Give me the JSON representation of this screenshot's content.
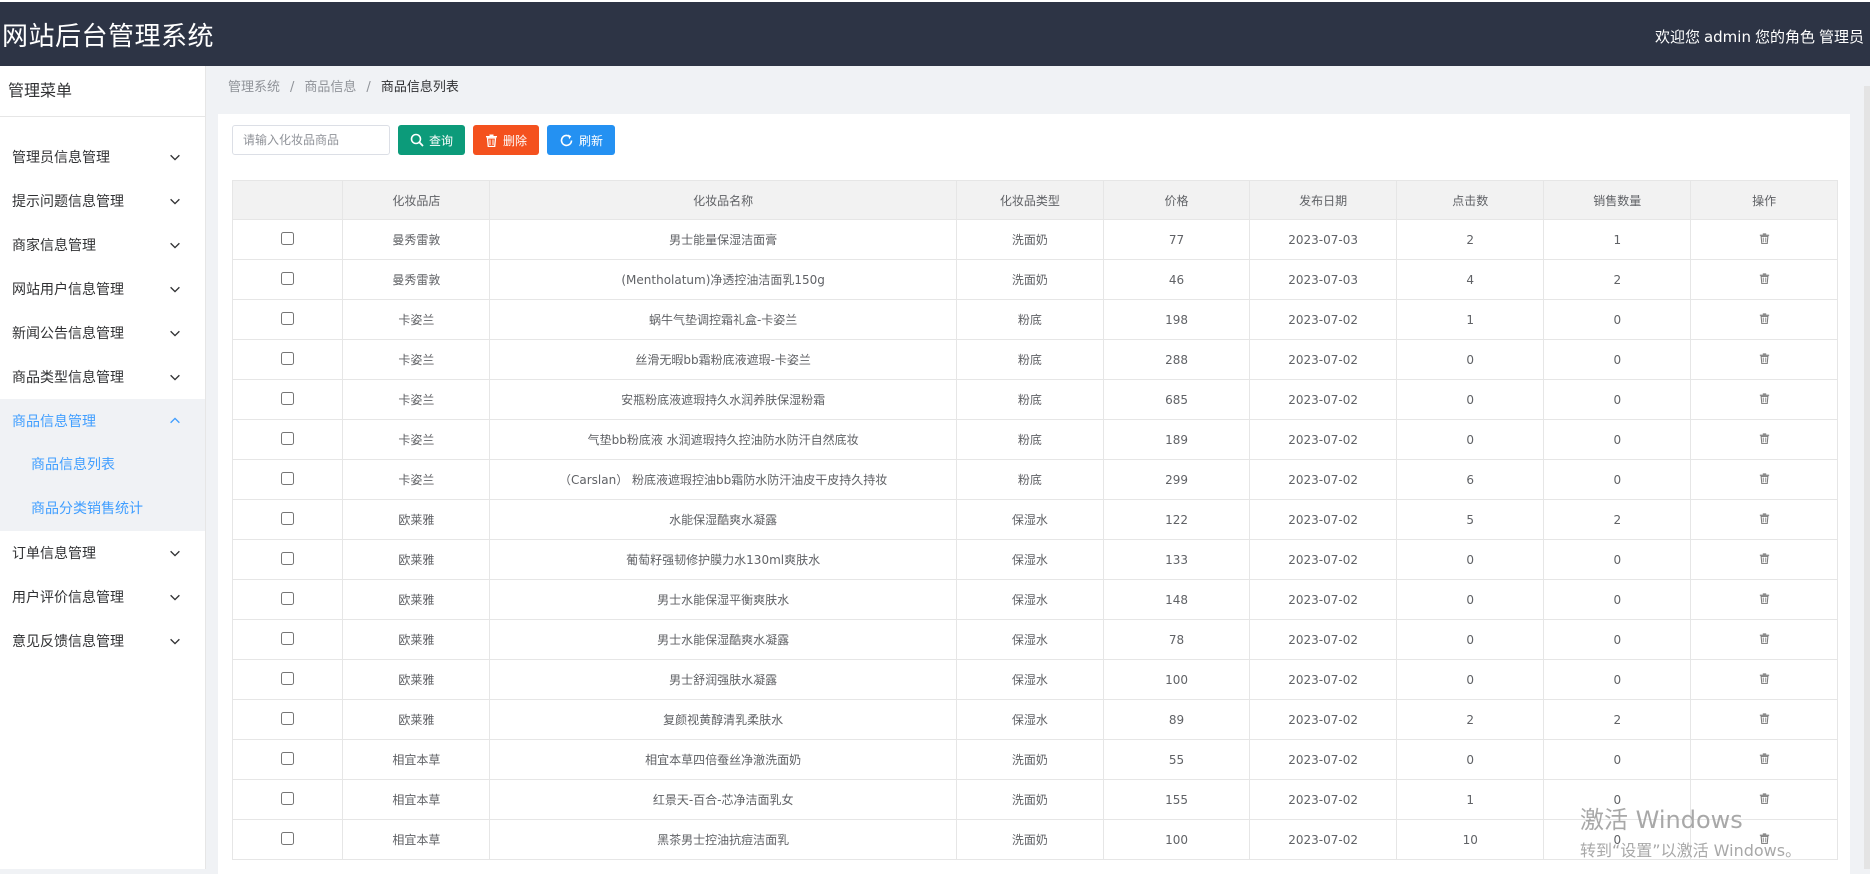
{
  "header": {
    "title": "网站后台管理系统",
    "welcome": "欢迎您",
    "username": "admin",
    "role_label": "您的角色",
    "role": "管理员"
  },
  "sidebar": {
    "title": "管理菜单",
    "items": [
      {
        "label": "管理员信息管理",
        "icon": "chevron-down-icon"
      },
      {
        "label": "提示问题信息管理",
        "icon": "chevron-down-icon"
      },
      {
        "label": "商家信息管理",
        "icon": "chevron-down-icon"
      },
      {
        "label": "网站用户信息管理",
        "icon": "chevron-down-icon"
      },
      {
        "label": "新闻公告信息管理",
        "icon": "chevron-down-icon"
      },
      {
        "label": "商品类型信息管理",
        "icon": "chevron-down-icon"
      },
      {
        "label": "商品信息管理",
        "icon": "chevron-up-icon",
        "active": true
      },
      {
        "label": "订单信息管理",
        "icon": "chevron-down-icon"
      },
      {
        "label": "用户评价信息管理",
        "icon": "chevron-down-icon"
      },
      {
        "label": "意见反馈信息管理",
        "icon": "chevron-down-icon"
      }
    ],
    "submenu": [
      "商品信息列表",
      "商品分类销售统计"
    ]
  },
  "breadcrumb": [
    "管理系统",
    "商品信息",
    "商品信息列表"
  ],
  "toolbar": {
    "search_placeholder": "请输入化妆品商品",
    "query_label": "查询",
    "delete_label": "删除",
    "refresh_label": "刷新"
  },
  "table": {
    "headers": [
      "",
      "化妆品店",
      "化妆品名称",
      "化妆品类型",
      "价格",
      "发布日期",
      "点击数",
      "销售数量",
      "操作"
    ],
    "rows": [
      [
        "曼秀雷敦",
        "男士能量保湿洁面膏",
        "洗面奶",
        "77",
        "2023-07-03",
        "2",
        "1"
      ],
      [
        "曼秀雷敦",
        "(Mentholatum)净透控油洁面乳150g",
        "洗面奶",
        "46",
        "2023-07-03",
        "4",
        "2"
      ],
      [
        "卡姿兰",
        "蜗牛气垫调控霜礼盒-卡姿兰",
        "粉底",
        "198",
        "2023-07-02",
        "1",
        "0"
      ],
      [
        "卡姿兰",
        "丝滑无暇bb霜粉底液遮瑕-卡姿兰",
        "粉底",
        "288",
        "2023-07-02",
        "0",
        "0"
      ],
      [
        "卡姿兰",
        "安瓶粉底液遮瑕持久水润养肤保湿粉霜",
        "粉底",
        "685",
        "2023-07-02",
        "0",
        "0"
      ],
      [
        "卡姿兰",
        "气垫bb粉底液 水润遮瑕持久控油防水防汗自然底妆",
        "粉底",
        "189",
        "2023-07-02",
        "0",
        "0"
      ],
      [
        "卡姿兰",
        "（Carslan） 粉底液遮瑕控油bb霜防水防汗油皮干皮持久持妆",
        "粉底",
        "299",
        "2023-07-02",
        "6",
        "0"
      ],
      [
        "欧莱雅",
        "水能保湿酷爽水凝露",
        "保湿水",
        "122",
        "2023-07-02",
        "5",
        "2"
      ],
      [
        "欧莱雅",
        "葡萄籽强韧修护膜力水130ml爽肤水",
        "保湿水",
        "133",
        "2023-07-02",
        "0",
        "0"
      ],
      [
        "欧莱雅",
        "男士水能保湿平衡爽肤水",
        "保湿水",
        "148",
        "2023-07-02",
        "0",
        "0"
      ],
      [
        "欧莱雅",
        "男士水能保湿酷爽水凝露",
        "保湿水",
        "78",
        "2023-07-02",
        "0",
        "0"
      ],
      [
        "欧莱雅",
        "男士舒润强肤水凝露",
        "保湿水",
        "100",
        "2023-07-02",
        "0",
        "0"
      ],
      [
        "欧莱雅",
        "复颜视黄醇清乳柔肤水",
        "保湿水",
        "89",
        "2023-07-02",
        "2",
        "2"
      ],
      [
        "相宜本草",
        "相宜本草四倍蚕丝净澈洗面奶",
        "洗面奶",
        "55",
        "2023-07-02",
        "0",
        "0"
      ],
      [
        "相宜本草",
        "红景天-百合-芯净洁面乳女",
        "洗面奶",
        "155",
        "2023-07-02",
        "1",
        "0"
      ],
      [
        "相宜本草",
        "黑茶男士控油抗痘洁面乳",
        "洗面奶",
        "100",
        "2023-07-02",
        "10",
        "0"
      ]
    ]
  },
  "watermark": {
    "line1": "激活 Windows",
    "line2": "转到“设置”以激活 Windows。"
  },
  "colors": {
    "header_bg": "#2d3445",
    "active_menu": "#409eff",
    "query_btn": "#0c9b7a",
    "delete_btn": "#f4511e",
    "refresh_btn": "#2491f2"
  }
}
